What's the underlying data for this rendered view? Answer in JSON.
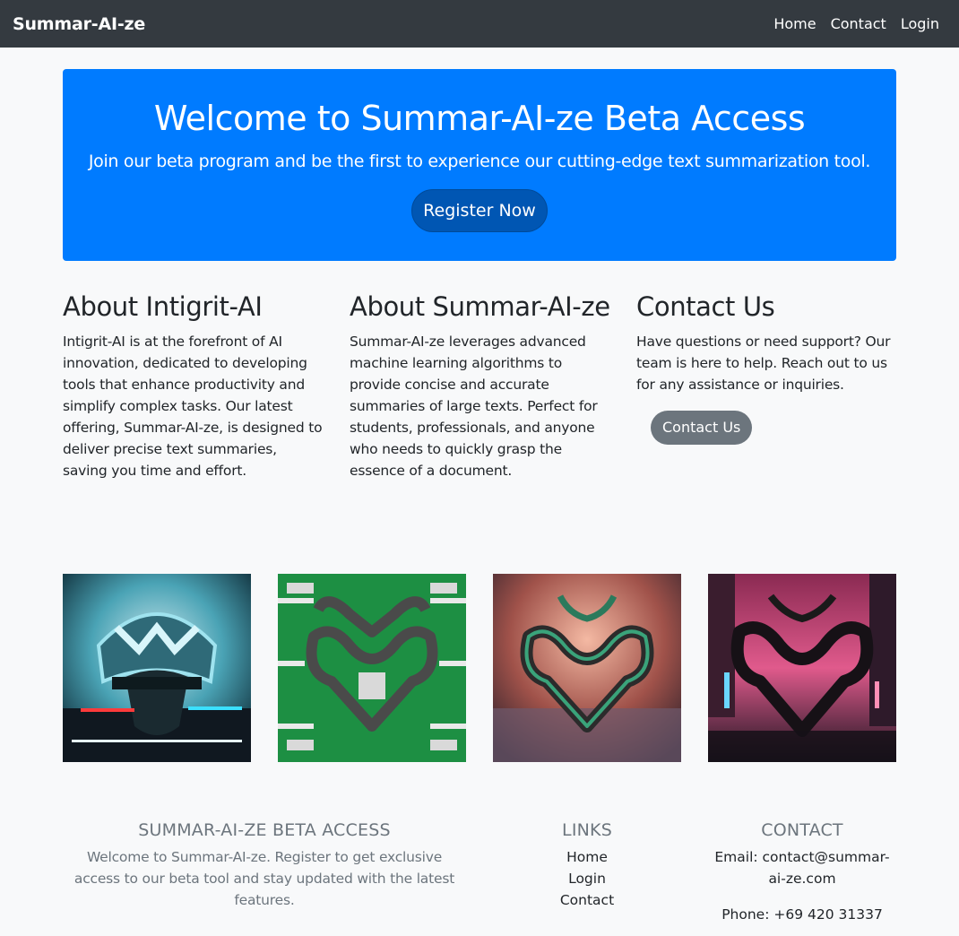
{
  "navbar": {
    "brand": "Summar-AI-ze",
    "links": [
      "Home",
      "Contact",
      "Login"
    ]
  },
  "hero": {
    "title": "Welcome to Summar-AI-ze Beta Access",
    "subtitle": "Join our beta program and be the first to experience our cutting-edge text summarization tool.",
    "button": "Register Now"
  },
  "sections": [
    {
      "title": "About Intigrit-AI",
      "text": "Intigrit-AI is at the forefront of AI innovation, dedicated to developing tools that enhance productivity and simplify complex tasks. Our latest offering, Summar-AI-ze, is designed to deliver precise text summaries, saving you time and effort."
    },
    {
      "title": "About Summar-AI-ze",
      "text": "Summar-AI-ze leverages advanced machine learning algorithms to provide concise and accurate summaries of large texts. Perfect for students, professionals, and anyone who needs to quickly grasp the essence of a document."
    },
    {
      "title": "Contact Us",
      "text": "Have questions or need support? Our team is here to help. Reach out to us for any assistance or inquiries.",
      "button": "Contact Us"
    }
  ],
  "gallery": [
    {
      "icon": "robot-helmet-image",
      "accent": "#38b6c7"
    },
    {
      "icon": "circuit-logo-green-image",
      "accent": "#1f9e4a"
    },
    {
      "icon": "circuit-logo-copper-image",
      "accent": "#c96a5a"
    },
    {
      "icon": "neon-city-logo-image",
      "accent": "#e0457f"
    }
  ],
  "footer": {
    "about_title": "SUMMAR-AI-ZE BETA ACCESS",
    "about_text": "Welcome to Summar-AI-ze. Register to get exclusive access to our beta tool and stay updated with the latest features.",
    "links_title": "LINKS",
    "links": [
      "Home",
      "Login",
      "Contact"
    ],
    "contact_title": "CONTACT",
    "email": "Email: contact@summar-ai-ze.com",
    "phone": "Phone: +69 420 31337"
  },
  "colors": {
    "navbar_bg": "#343a40",
    "hero_bg": "#007bff",
    "primary_button": "#0056b3",
    "secondary_button": "#6c757d",
    "page_bg": "#f8f9fa"
  }
}
